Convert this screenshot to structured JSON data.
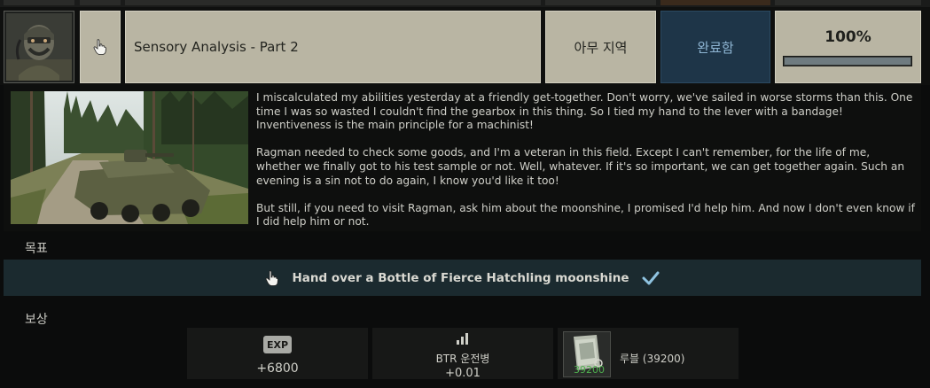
{
  "quest": {
    "title": "Sensory Analysis - Part 2",
    "location": "아무 지역",
    "status": "완료함",
    "progress_label": "100%",
    "progress": 1.0
  },
  "description": [
    "I miscalculated my abilities yesterday at a friendly get-together. Don't worry, we've sailed in worse storms than this. One time I was so wasted I couldn't find the gearbox in this thing. So I tied my hand to the lever with a bandage! Inventiveness is the main principle for a machinist!",
    "Ragman needed to check some goods, and I'm a veteran in this field. Except I can't remember, for the life of me, whether we finally got to his test sample or not. Well, whatever. If it's so important, we can get together again. Such an evening is a sin not to do again, I know you'd like it too!",
    "But still, if you need to visit Ragman, ask him about the moonshine, I promised I'd help him. And now I don't even know if I did help him or not."
  ],
  "objectives": {
    "label": "목표",
    "items": [
      {
        "text": "Hand over a Bottle of Fierce Hatchling moonshine",
        "done": true
      }
    ]
  },
  "rewards": {
    "label": "보상",
    "exp": {
      "badge": "EXP",
      "value": "+6800"
    },
    "skill": {
      "name": "BTR 운전병",
      "value": "+0.01"
    },
    "item": {
      "name": "루블 (39200)",
      "amount": "39200"
    }
  },
  "icons": {
    "hand": "pointer-hand-icon",
    "check": "checkmark-icon",
    "skill": "bar-chart-icon",
    "currency": "roubles-icon"
  },
  "colors": {
    "accent_complete": "#1e3548",
    "status_text": "#8fb6d4",
    "objective_bg": "#1b2a2f",
    "check": "#8fc3e0",
    "item_amount": "#4fb04f"
  }
}
